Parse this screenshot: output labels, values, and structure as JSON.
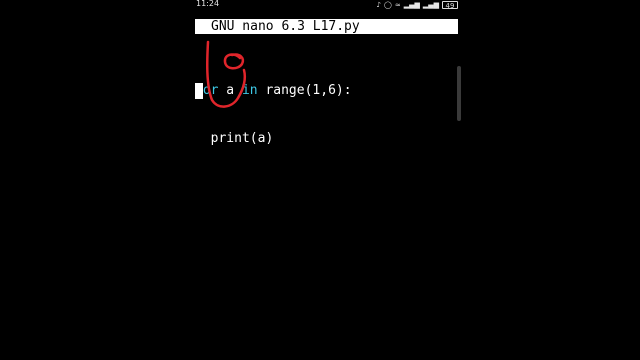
{
  "status_bar": {
    "time": "11:24",
    "icons": [
      "headphones-icon",
      "alarm-icon",
      "wifi-icon",
      "signal-icon",
      "signal-icon",
      "battery-icon"
    ],
    "battery_level": "49"
  },
  "editor": {
    "title": "GNU nano 6.3 L17.py",
    "lines": [
      {
        "kw1": "for",
        "t1": " a ",
        "kw2": "in",
        "t2": " range(1,6):"
      },
      {
        "text": "  print(a)"
      }
    ]
  },
  "colors": {
    "keyword": "#3ec9e6",
    "annotation": "#e0252b",
    "titlebar_bg": "#ffffff",
    "background": "#000000"
  }
}
